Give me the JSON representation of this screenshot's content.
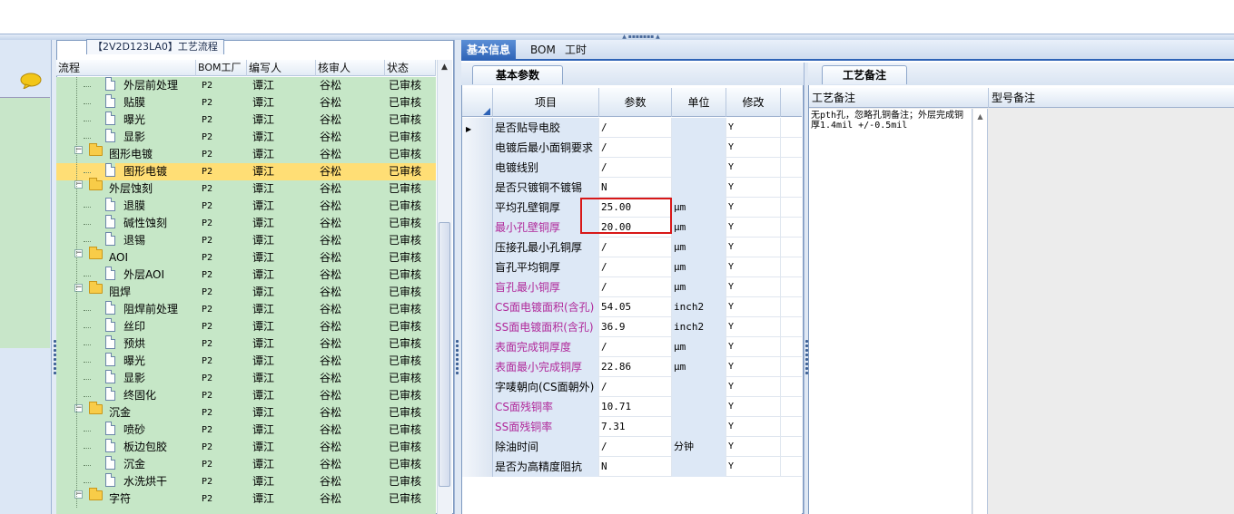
{
  "tree": {
    "panel_title": "【2V2D123LA0】工艺流程",
    "columns": [
      "流程",
      "BOM工厂",
      "编写人",
      "核审人",
      "状态"
    ],
    "rows": [
      {
        "name": "外层前处理",
        "level": 2,
        "kind": "doc",
        "bom": "P2",
        "writer": "谭江",
        "reviewer": "谷松",
        "status": "已审核"
      },
      {
        "name": "贴膜",
        "level": 2,
        "kind": "doc",
        "bom": "P2",
        "writer": "谭江",
        "reviewer": "谷松",
        "status": "已审核"
      },
      {
        "name": "曝光",
        "level": 2,
        "kind": "doc",
        "bom": "P2",
        "writer": "谭江",
        "reviewer": "谷松",
        "status": "已审核"
      },
      {
        "name": "显影",
        "level": 2,
        "kind": "doc",
        "bom": "P2",
        "writer": "谭江",
        "reviewer": "谷松",
        "status": "已审核"
      },
      {
        "name": "图形电镀",
        "level": 1,
        "kind": "folder",
        "bom": "P2",
        "writer": "谭江",
        "reviewer": "谷松",
        "status": "已审核"
      },
      {
        "name": "图形电镀",
        "level": 2,
        "kind": "doc",
        "bom": "P2",
        "writer": "谭江",
        "reviewer": "谷松",
        "status": "已审核",
        "selected": true
      },
      {
        "name": "外层蚀刻",
        "level": 1,
        "kind": "folder",
        "bom": "P2",
        "writer": "谭江",
        "reviewer": "谷松",
        "status": "已审核"
      },
      {
        "name": "退膜",
        "level": 2,
        "kind": "doc",
        "bom": "P2",
        "writer": "谭江",
        "reviewer": "谷松",
        "status": "已审核"
      },
      {
        "name": "碱性蚀刻",
        "level": 2,
        "kind": "doc",
        "bom": "P2",
        "writer": "谭江",
        "reviewer": "谷松",
        "status": "已审核"
      },
      {
        "name": "退锡",
        "level": 2,
        "kind": "doc",
        "bom": "P2",
        "writer": "谭江",
        "reviewer": "谷松",
        "status": "已审核"
      },
      {
        "name": "AOI",
        "level": 1,
        "kind": "folder",
        "bom": "P2",
        "writer": "谭江",
        "reviewer": "谷松",
        "status": "已审核"
      },
      {
        "name": "外层AOI",
        "level": 2,
        "kind": "doc",
        "bom": "P2",
        "writer": "谭江",
        "reviewer": "谷松",
        "status": "已审核"
      },
      {
        "name": "阻焊",
        "level": 1,
        "kind": "folder",
        "bom": "P2",
        "writer": "谭江",
        "reviewer": "谷松",
        "status": "已审核"
      },
      {
        "name": "阻焊前处理",
        "level": 2,
        "kind": "doc",
        "bom": "P2",
        "writer": "谭江",
        "reviewer": "谷松",
        "status": "已审核"
      },
      {
        "name": "丝印",
        "level": 2,
        "kind": "doc",
        "bom": "P2",
        "writer": "谭江",
        "reviewer": "谷松",
        "status": "已审核"
      },
      {
        "name": "预烘",
        "level": 2,
        "kind": "doc",
        "bom": "P2",
        "writer": "谭江",
        "reviewer": "谷松",
        "status": "已审核"
      },
      {
        "name": "曝光",
        "level": 2,
        "kind": "doc",
        "bom": "P2",
        "writer": "谭江",
        "reviewer": "谷松",
        "status": "已审核"
      },
      {
        "name": "显影",
        "level": 2,
        "kind": "doc",
        "bom": "P2",
        "writer": "谭江",
        "reviewer": "谷松",
        "status": "已审核"
      },
      {
        "name": "终固化",
        "level": 2,
        "kind": "doc",
        "bom": "P2",
        "writer": "谭江",
        "reviewer": "谷松",
        "status": "已审核"
      },
      {
        "name": "沉金",
        "level": 1,
        "kind": "folder",
        "bom": "P2",
        "writer": "谭江",
        "reviewer": "谷松",
        "status": "已审核"
      },
      {
        "name": "喷砂",
        "level": 2,
        "kind": "doc",
        "bom": "P2",
        "writer": "谭江",
        "reviewer": "谷松",
        "status": "已审核"
      },
      {
        "name": "板边包胶",
        "level": 2,
        "kind": "doc",
        "bom": "P2",
        "writer": "谭江",
        "reviewer": "谷松",
        "status": "已审核"
      },
      {
        "name": "沉金",
        "level": 2,
        "kind": "doc",
        "bom": "P2",
        "writer": "谭江",
        "reviewer": "谷松",
        "status": "已审核"
      },
      {
        "name": "水洗烘干",
        "level": 2,
        "kind": "doc",
        "bom": "P2",
        "writer": "谭江",
        "reviewer": "谷松",
        "status": "已审核"
      },
      {
        "name": "字符",
        "level": 1,
        "kind": "folder",
        "bom": "P2",
        "writer": "谭江",
        "reviewer": "谷松",
        "status": "已审核"
      }
    ]
  },
  "main_tabs": [
    "基本信息",
    "BOM",
    "工时"
  ],
  "params_panel": {
    "tab": "基本参数",
    "columns": [
      "项目",
      "参数",
      "单位",
      "修改"
    ],
    "rows": [
      {
        "item": "是否贴导电胶",
        "value": "/",
        "unit": "",
        "mod": "Y",
        "magenta": false,
        "current": true
      },
      {
        "item": "电镀后最小面铜要求",
        "value": "/",
        "unit": "",
        "mod": "Y",
        "magenta": false
      },
      {
        "item": "电镀线别",
        "value": "/",
        "unit": "",
        "mod": "Y",
        "magenta": false
      },
      {
        "item": "是否只镀铜不镀锡",
        "value": "N",
        "unit": "",
        "mod": "Y",
        "magenta": false
      },
      {
        "item": "平均孔壁铜厚",
        "value": "25.00",
        "unit": "μm",
        "mod": "Y",
        "magenta": false
      },
      {
        "item": "最小孔壁铜厚",
        "value": "20.00",
        "unit": "μm",
        "mod": "Y",
        "magenta": true
      },
      {
        "item": "压接孔最小孔铜厚",
        "value": "/",
        "unit": "μm",
        "mod": "Y",
        "magenta": false
      },
      {
        "item": "盲孔平均铜厚",
        "value": "/",
        "unit": "μm",
        "mod": "Y",
        "magenta": false
      },
      {
        "item": "盲孔最小铜厚",
        "value": "/",
        "unit": "μm",
        "mod": "Y",
        "magenta": true
      },
      {
        "item": "CS面电镀面积(含孔)",
        "value": "54.05",
        "unit": "inch2",
        "mod": "Y",
        "magenta": true
      },
      {
        "item": "SS面电镀面积(含孔)",
        "value": "36.9",
        "unit": "inch2",
        "mod": "Y",
        "magenta": true
      },
      {
        "item": "表面完成铜厚度",
        "value": "/",
        "unit": "μm",
        "mod": "Y",
        "magenta": true
      },
      {
        "item": "表面最小完成铜厚",
        "value": "22.86",
        "unit": "μm",
        "mod": "Y",
        "magenta": true
      },
      {
        "item": "字唛朝向(CS面朝外)",
        "value": "/",
        "unit": "",
        "mod": "Y",
        "magenta": false
      },
      {
        "item": "CS面残铜率",
        "value": "10.71",
        "unit": "",
        "mod": "Y",
        "magenta": true
      },
      {
        "item": "SS面残铜率",
        "value": "7.31",
        "unit": "",
        "mod": "Y",
        "magenta": true
      },
      {
        "item": "除油时间",
        "value": "/",
        "unit": "分钟",
        "mod": "Y",
        "magenta": false
      },
      {
        "item": "是否为高精度阻抗",
        "value": "N",
        "unit": "",
        "mod": "Y",
        "magenta": false
      }
    ]
  },
  "notes_panel": {
    "tab": "工艺备注",
    "columns": [
      "工艺备注",
      "型号备注"
    ],
    "process_note": "无pth孔，忽略孔铜备注；外层完成铜厚1.4mil +/-0.5mil",
    "model_note": ""
  },
  "colors": {
    "tree_bg": "#c6e7c7",
    "selected_row": "#ffde75",
    "magenta_text": "#b0289a",
    "highlight_box": "#d81818",
    "active_tab": "#2d62b6"
  }
}
